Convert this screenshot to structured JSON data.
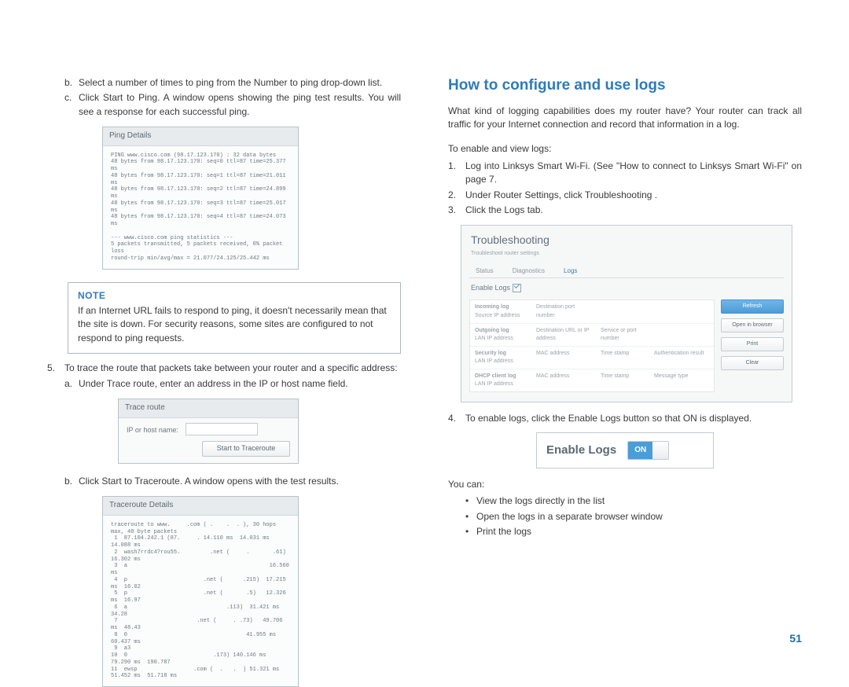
{
  "page_number": "51",
  "left": {
    "steps": [
      {
        "marker": "b.",
        "text": "Select a number of times to ping from the Number to ping  drop-down list."
      },
      {
        "marker": "c.",
        "text": "Click Start to Ping. A window opens showing the ping test results. You will see a response for each successful ping."
      }
    ],
    "ping_fig": {
      "title": "Ping Details",
      "lines": "PING www.cisco.com (98.17.123.170) : 32 data bytes\n48 bytes from 98.17.123.170: seq=0 ttl=87 time=25.377 ms\n48 bytes from 98.17.123.170: seq=1 ttl=87 time=21.011 ms\n48 bytes from 98.17.123.170: seq=2 ttl=87 time=24.899 ms\n48 bytes from 98.17.123.170: seq=3 ttl=87 time=25.017 ms\n48 bytes from 98.17.123.170: seq=4 ttl=87 time=24.073 ms\n\n--- www.cisco.com ping statistics ---\n5 packets transmitted, 5 packets received, 0% packet loss\nround-trip min/avg/max = 21.077/24.125/25.442 ms"
    },
    "note_title": "NOTE",
    "note_body": "If an Internet URL fails to respond to ping, it doesn't necessarily mean that the site is down. For security reasons, some sites are configured to not respond to ping requests.",
    "step5": {
      "marker": "5.",
      "text": "To trace the route that packets take between your router and a specific address:"
    },
    "step5a": {
      "marker": "a.",
      "text": "Under Trace route, enter an address in the IP or host name field."
    },
    "trace_fig": {
      "title": "Trace route",
      "label": "IP or host name:",
      "button": "Start to Traceroute"
    },
    "step5b": {
      "marker": "b.",
      "text": "Click Start to Traceroute. A window opens with the test results."
    },
    "trdetails": {
      "title": "Traceroute Details",
      "lines": "traceroute to www.     .com ( .    .  . ), 30 hops max, 40 byte packets\n 1  87.104.242.1 (87.     . 14.110 ms  14.031 ms  14.088 ms\n 2  wash7rrdc4?rou55.         .net (     .       .61)  16.302 ms\n 3  a                                           16.560 ms\n 4  p                       .net (      .215)  17.215 ms  16.02\n 5  p                       .net (       .5)   12.326 ms  16.97\n 6  a                              .113)  31.421 ms  34.28\n 7                        .net (     . .73)   49.706 ms  48.43\n 8  0                                    41.955 ms  60.437 ms\n 9  a3                                   \n10  0                          .173) 140.146 ms  79.290 ms  190.787\n11  ewsp                 .com (  .   .  ) 51.321 ms  51.452 ms  51.718 ms"
    }
  },
  "right": {
    "heading": "How to configure and use logs",
    "intro": "What kind of logging capabilities does my router have?  Your router can track all traffic for your Internet connection and record that information in a log.",
    "enable_intro": "To enable and view logs:",
    "steps": [
      {
        "marker": "1.",
        "text": "Log into Linksys Smart Wi-Fi. (See \"How to connect to Linksys Smart Wi-Fi\" on page 7."
      },
      {
        "marker": "2.",
        "text": "Under Router Settings, click Troubleshooting ."
      },
      {
        "marker": "3.",
        "text": "Click the Logs tab."
      }
    ],
    "ts": {
      "title": "Troubleshooting",
      "subtitle": "Troubleshoot router settings",
      "tabs": [
        "Status",
        "Diagnostics",
        "Logs"
      ],
      "enable_label": "Enable Logs",
      "rows": [
        {
          "h": "Incoming log",
          "c1": "Source IP address",
          "c2": "Destination port number",
          "c3": "",
          "c4": ""
        },
        {
          "h": "Outgoing log",
          "c1": "LAN IP address",
          "c2": "Destination URL or IP address",
          "c3": "Service or port number",
          "c4": ""
        },
        {
          "h": "Security log",
          "c1": "LAN IP address",
          "c2": "MAC address",
          "c3": "Time stamp",
          "c4": "Authentication result"
        },
        {
          "h": "DHCP client log",
          "c1": "LAN IP address",
          "c2": "MAC address",
          "c3": "Time stamp",
          "c4": "Message type"
        }
      ],
      "buttons": [
        "Refresh",
        "Open in browser",
        "Print",
        "Clear"
      ]
    },
    "step4": {
      "marker": "4.",
      "text": "To enable logs, click the Enable Logs button so that ON is displayed."
    },
    "enable_fig": {
      "label": "Enable Logs",
      "state": "ON"
    },
    "you_can": "You can:",
    "bullets": [
      "View the logs directly in the list",
      "Open the logs in a separate browser window",
      "Print the logs"
    ]
  }
}
